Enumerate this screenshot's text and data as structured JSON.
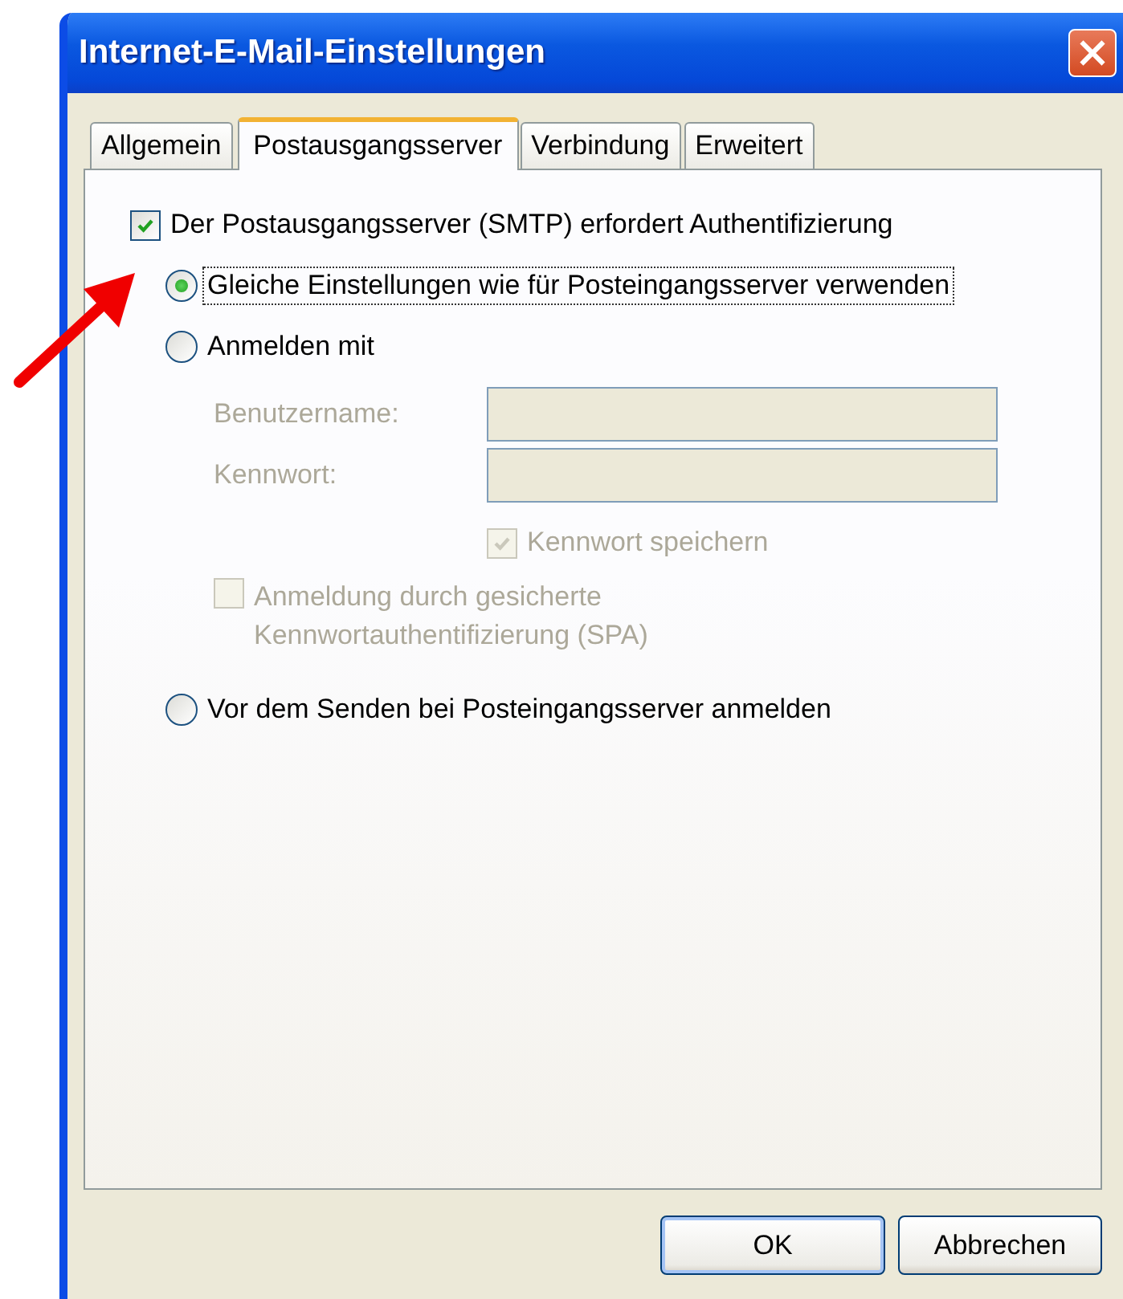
{
  "window": {
    "title": "Internet-E-Mail-Einstellungen"
  },
  "tabs": [
    {
      "label": "Allgemein",
      "selected": false
    },
    {
      "label": "Postausgangsserver",
      "selected": true
    },
    {
      "label": "Verbindung",
      "selected": false
    },
    {
      "label": "Erweitert",
      "selected": false
    }
  ],
  "auth_required": {
    "label": "Der Postausgangsserver (SMTP) erfordert Authentifizierung",
    "checked": true
  },
  "options": [
    {
      "label": "Gleiche Einstellungen wie für Posteingangsserver verwenden",
      "selected": true,
      "focused": true
    },
    {
      "label": "Anmelden mit",
      "selected": false,
      "focused": false,
      "fields": [
        {
          "label": "Benutzername:",
          "disabled": true
        },
        {
          "label": "Kennwort:",
          "disabled": true
        }
      ],
      "save_password": {
        "label": "Kennwort speichern",
        "checked": true,
        "disabled": true
      },
      "spa": {
        "label": "Anmeldung durch gesicherte Kennwortauthentifizierung (SPA)",
        "checked": false,
        "disabled": true
      }
    },
    {
      "label": "Vor dem Senden bei Posteingangsserver anmelden",
      "selected": false,
      "focused": false
    }
  ],
  "buttons": [
    {
      "label": "OK",
      "default": true
    },
    {
      "label": "Abbrechen",
      "default": false
    }
  ]
}
